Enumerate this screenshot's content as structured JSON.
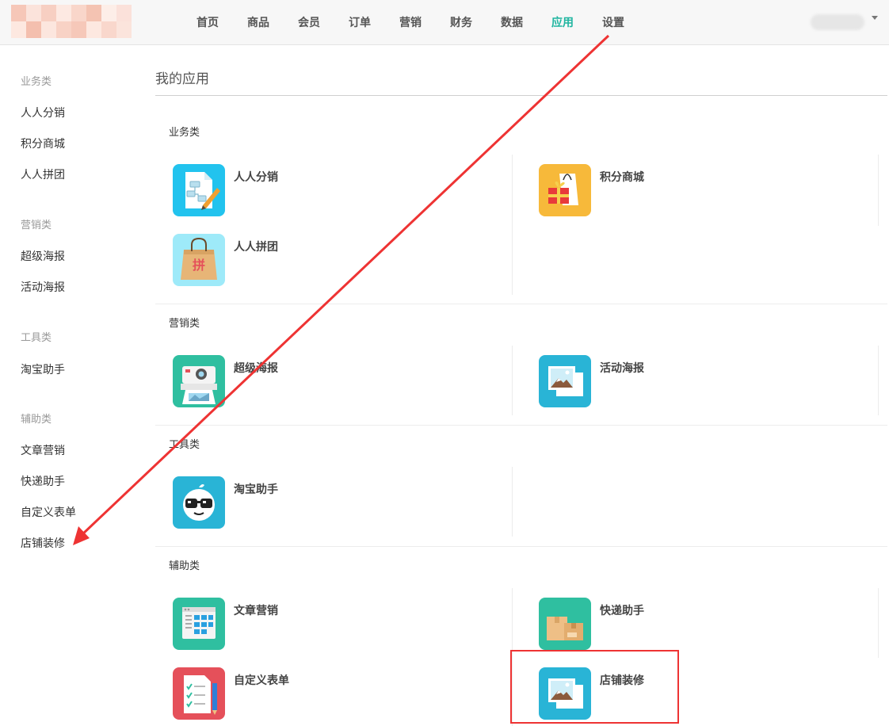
{
  "nav": {
    "items": [
      {
        "label": "首页"
      },
      {
        "label": "商品"
      },
      {
        "label": "会员"
      },
      {
        "label": "订单"
      },
      {
        "label": "营销"
      },
      {
        "label": "财务"
      },
      {
        "label": "数据"
      },
      {
        "label": "应用",
        "active": true
      },
      {
        "label": "设置"
      }
    ]
  },
  "sidebar": {
    "groups": [
      {
        "title": "业务类",
        "items": [
          "人人分销",
          "积分商城",
          "人人拼团"
        ]
      },
      {
        "title": "营销类",
        "items": [
          "超级海报",
          "活动海报"
        ]
      },
      {
        "title": "工具类",
        "items": [
          "淘宝助手"
        ]
      },
      {
        "title": "辅助类",
        "items": [
          "文章营销",
          "快递助手",
          "自定义表单",
          "店铺装修"
        ]
      }
    ]
  },
  "main": {
    "title": "我的应用",
    "sections": [
      {
        "title": "业务类",
        "apps": [
          {
            "name": "人人分销",
            "icon": "distribution-flowchart-icon"
          },
          {
            "name": "积分商城",
            "icon": "gift-bag-icon"
          },
          {
            "name": "人人拼团",
            "icon": "shopping-bag-pin-icon",
            "badge": "拼"
          }
        ]
      },
      {
        "title": "营销类",
        "apps": [
          {
            "name": "超级海报",
            "icon": "poster-camera-icon"
          },
          {
            "name": "活动海报",
            "icon": "picture-icon"
          }
        ]
      },
      {
        "title": "工具类",
        "apps": [
          {
            "name": "淘宝助手",
            "icon": "taobao-glasses-icon"
          }
        ]
      },
      {
        "title": "辅助类",
        "apps": [
          {
            "name": "文章营销",
            "icon": "article-grid-icon"
          },
          {
            "name": "快递助手",
            "icon": "parcel-boxes-icon"
          },
          {
            "name": "自定义表单",
            "icon": "form-checklist-icon"
          },
          {
            "name": "店铺装修",
            "icon": "picture-icon"
          }
        ]
      }
    ]
  },
  "colors": {
    "accent": "#1fb5a0",
    "annotation": "#e33333",
    "cyan": "#29b6f6",
    "teal": "#2fbfa0",
    "orange": "#f7b93a",
    "light_cyan": "#9eeaf9",
    "red": "#e5505a",
    "blue": "#29b4d6"
  }
}
